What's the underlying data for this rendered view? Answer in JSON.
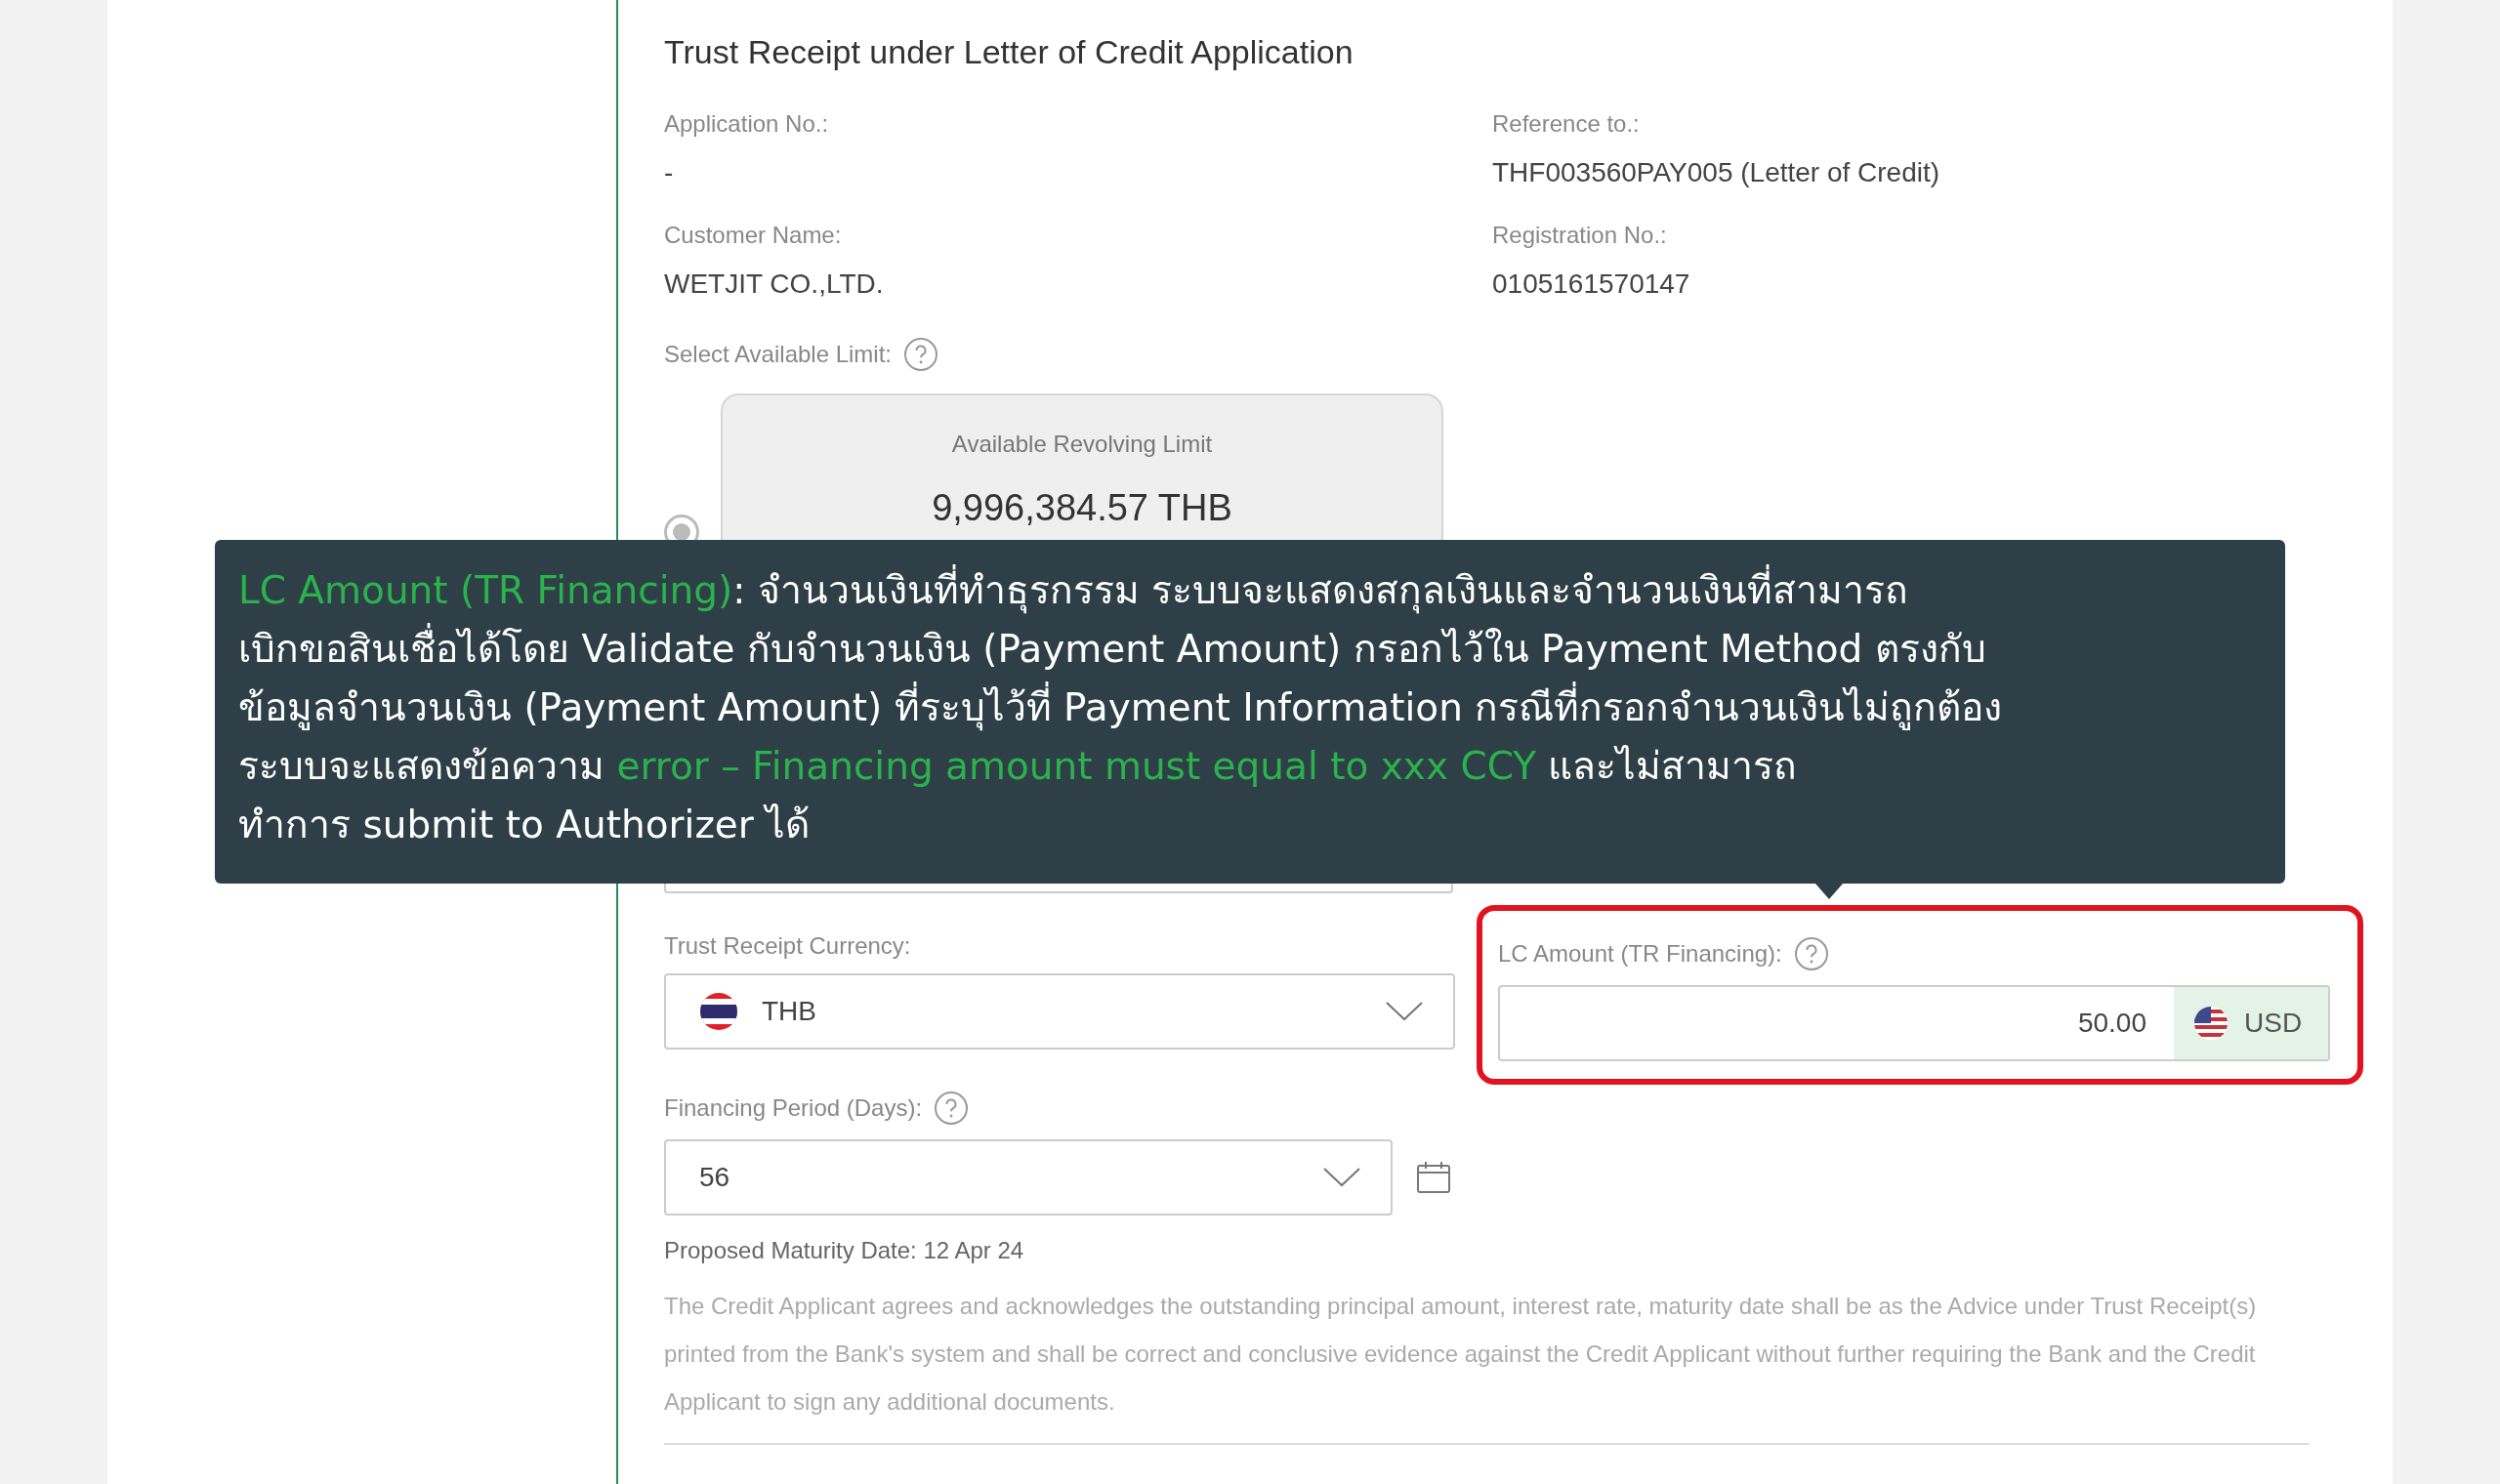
{
  "form": {
    "title": "Trust Receipt under Letter of Credit Application",
    "details": [
      {
        "label": "Application No.:",
        "value": "-"
      },
      {
        "label": "Reference to.:",
        "value": "THF003560PAY005 (Letter of Credit)"
      },
      {
        "label": "Customer Name:",
        "value": "WETJIT CO.,LTD."
      },
      {
        "label": "Registration No.:",
        "value": "0105161570147"
      }
    ],
    "limit": {
      "label": "Select Available Limit:",
      "card_title": "Available Revolving Limit",
      "amount": "9,996,384.57 THB",
      "selected": true
    },
    "currency": {
      "label": "Trust Receipt Currency:",
      "value": "THB"
    },
    "lc_amount": {
      "label": "LC Amount (TR Financing):",
      "value": "50.00",
      "currency": "USD",
      "highlighted": true
    },
    "period": {
      "label": "Financing Period (Days):",
      "value": "56"
    },
    "maturity": "Proposed Maturity Date: 12 Apr 24",
    "disclaimer": "The Credit Applicant agrees and acknowledges the outstanding principal amount, interest rate, maturity date shall be as the Advice under Trust Receipt(s) printed from the Bank's system and shall be correct and conclusive evidence against the Credit Applicant without further requiring the Bank and the Credit Applicant to sign any additional documents."
  },
  "tooltip": {
    "lines": [
      [
        {
          "text": "LC Amount (TR Financing)",
          "highlight": true
        },
        {
          "text": ": จำนวนเงินที่ทำธุรกรรม ระบบจะแสดงสกุลเงินและจำนวนเงินที่สามารถ",
          "highlight": false
        }
      ],
      [
        {
          "text": "เบิกขอสินเชื่อได้โดย Validate กับจำนวนเงิน (Payment Amount) กรอกไว้ใน Payment Method ตรงกับ",
          "highlight": false
        }
      ],
      [
        {
          "text": "ข้อมูลจำนวนเงิน (Payment Amount) ที่ระบุไว้ที่ Payment Information กรณีที่กรอกจำนวนเงินไม่ถูกต้อง",
          "highlight": false
        }
      ],
      [
        {
          "text": "ระบบจะแสดงข้อความ ",
          "highlight": false
        },
        {
          "text": "error – Financing amount must equal to xxx CCY",
          "highlight": true
        },
        {
          "text": " และไม่สามารถ",
          "highlight": false
        }
      ],
      [
        {
          "text": "ทำการ submit to Authorizer ได้",
          "highlight": false
        }
      ]
    ]
  }
}
